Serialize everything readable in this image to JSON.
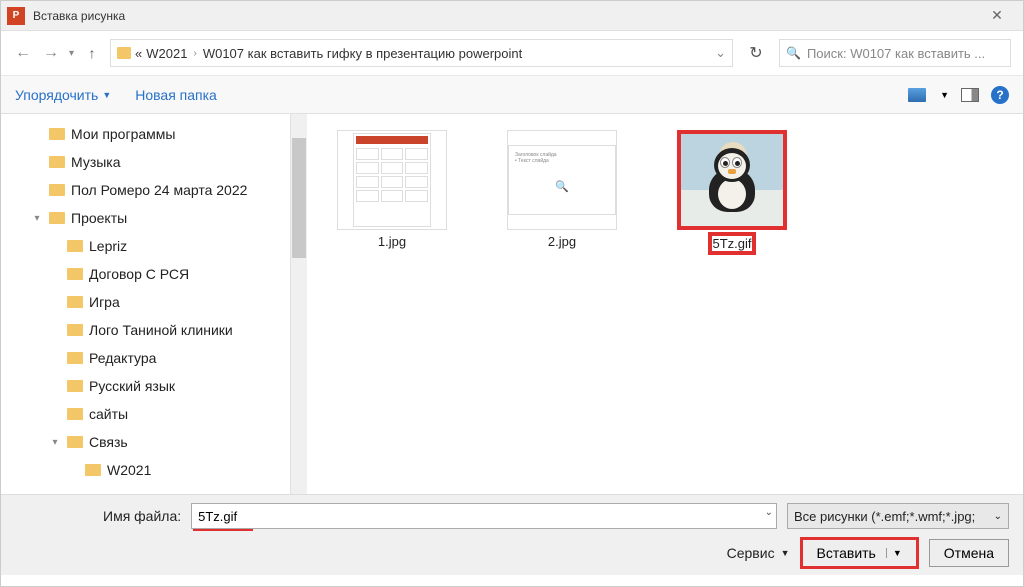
{
  "title": "Вставка рисунка",
  "nav": {
    "path_prefix": "«",
    "crumb1": "W2021",
    "crumb2": "W0107 как вставить гифку в презентацию powerpoint",
    "search_placeholder": "Поиск: W0107 как вставить ..."
  },
  "toolbar": {
    "organize": "Упорядочить",
    "new_folder": "Новая папка"
  },
  "tree": [
    {
      "label": "Мои программы",
      "lvl": 0,
      "exp": ""
    },
    {
      "label": "Музыка",
      "lvl": 0,
      "exp": ""
    },
    {
      "label": "Пол Ромеро 24 марта 2022",
      "lvl": 0,
      "exp": ""
    },
    {
      "label": "Проекты",
      "lvl": 0,
      "exp": "▾"
    },
    {
      "label": "Lepriz",
      "lvl": 1,
      "exp": ""
    },
    {
      "label": "Договор С РСЯ",
      "lvl": 1,
      "exp": ""
    },
    {
      "label": "Игра",
      "lvl": 1,
      "exp": ""
    },
    {
      "label": "Лого Таниной клиники",
      "lvl": 1,
      "exp": ""
    },
    {
      "label": "Редактура",
      "lvl": 1,
      "exp": ""
    },
    {
      "label": "Русский язык",
      "lvl": 1,
      "exp": ""
    },
    {
      "label": "сайты",
      "lvl": 1,
      "exp": ""
    },
    {
      "label": "Связь",
      "lvl": 1,
      "exp": "▾"
    },
    {
      "label": "W2021",
      "lvl": 2,
      "exp": ""
    }
  ],
  "files": [
    {
      "name": "1.jpg",
      "selected": false
    },
    {
      "name": "2.jpg",
      "selected": false
    },
    {
      "name": "5Tz.gif",
      "selected": true
    }
  ],
  "bottom": {
    "filename_label": "Имя файла:",
    "filename_value": "5Tz.gif",
    "filter": "Все рисунки (*.emf;*.wmf;*.jpg;",
    "service": "Сервис",
    "insert": "Вставить",
    "cancel": "Отмена"
  }
}
